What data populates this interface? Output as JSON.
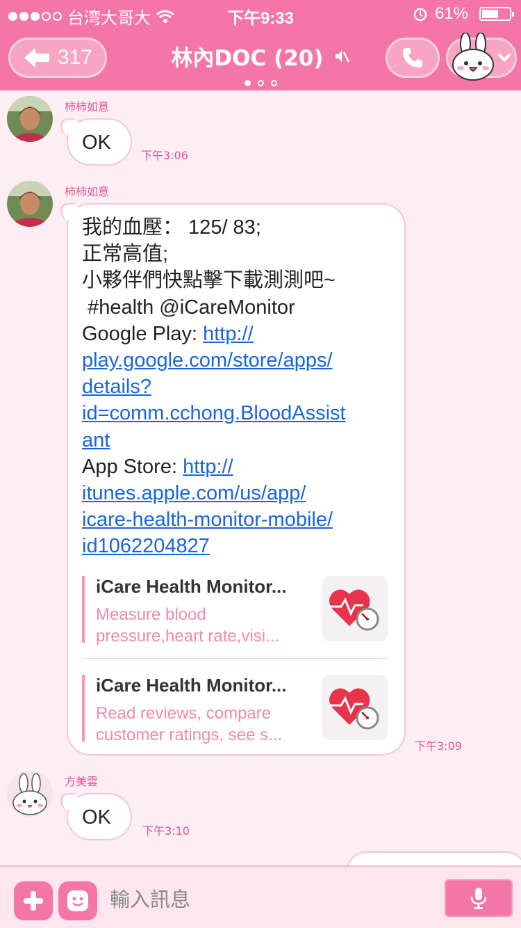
{
  "status_bar": {
    "carrier": "台湾大哥大",
    "time": "下午9:33",
    "battery": "61%",
    "battery_level": 0.61
  },
  "header": {
    "back_count": "317",
    "chat_title": "林內DOC (20)"
  },
  "messages": [
    {
      "sender": "柿柿如意",
      "text": "OK",
      "time": "下午3:06"
    },
    {
      "sender": "柿柿如意",
      "lines": {
        "l1": "我的血壓： 125/ 83;",
        "l2": "正常高值;",
        "l3": "小夥伴們快點擊下載測測吧~",
        "l4": " #health @iCareMonitor",
        "l5a": "Google Play: ",
        "link1a": "http://",
        "link1b": "play.google.com/store/apps/",
        "link1c": "details?",
        "link1d": "id=comm.cchong.BloodAssist",
        "link1e": "ant",
        "l6a": "App Store: ",
        "link2a": "http://",
        "link2b": "itunes.apple.com/us/app/",
        "link2c": "icare-health-monitor-mobile/",
        "link2d": "id1062204827"
      },
      "previews": [
        {
          "title": "iCare Health Monitor...",
          "desc1": "Measure blood",
          "desc2": "pressure,heart rate,visi..."
        },
        {
          "title": "iCare Health Monitor...",
          "desc1": "Read reviews, compare",
          "desc2": "customer ratings, see s..."
        }
      ],
      "time": "下午3:09"
    },
    {
      "sender": "方美雲",
      "text": "OK",
      "time": "下午3:10"
    }
  ],
  "input_bar": {
    "placeholder": "輸入訊息"
  },
  "colors": {
    "accent": "#f476a6",
    "link": "#1a66d8",
    "background": "#fdeef3"
  }
}
